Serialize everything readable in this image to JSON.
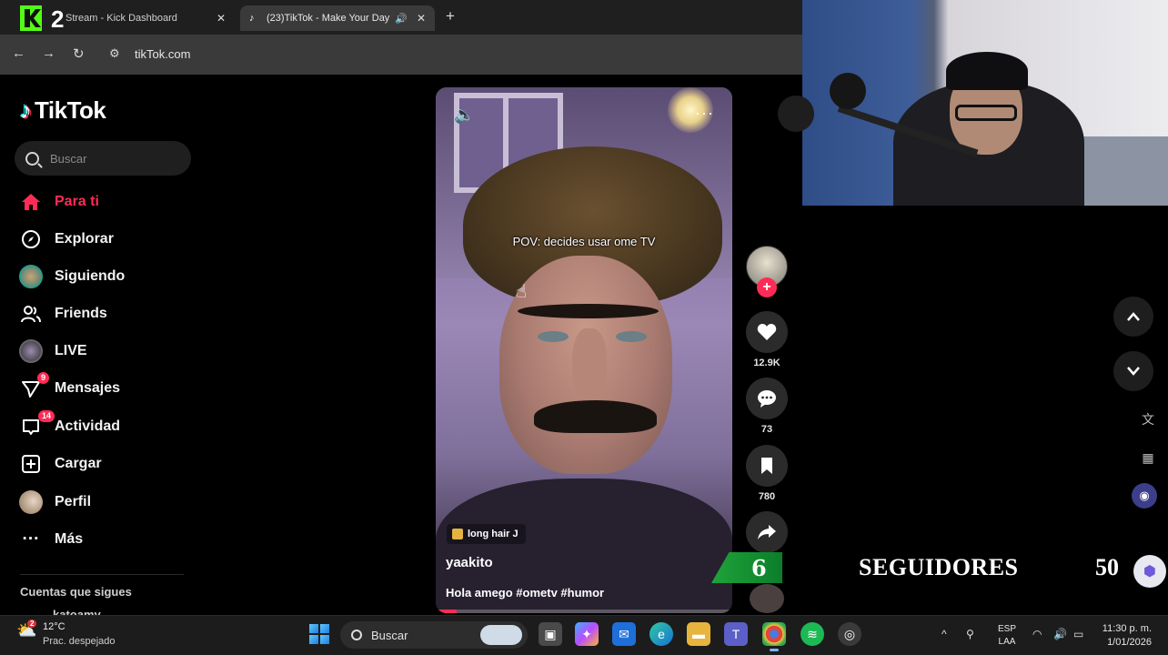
{
  "browser": {
    "tabs": [
      {
        "title": "Stream - Kick Dashboard",
        "active": false
      },
      {
        "title": "(23)TikTok - Make Your Day",
        "active": true
      }
    ],
    "url": "tikTok.com"
  },
  "stream_logo": "K2",
  "tiktok": {
    "brand": "TikTok",
    "search_placeholder": "Buscar",
    "nav": [
      {
        "label": "Para ti",
        "icon": "home-icon",
        "active": true
      },
      {
        "label": "Explorar",
        "icon": "compass-icon"
      },
      {
        "label": "Siguiendo",
        "icon": "avatar-icon"
      },
      {
        "label": "Friends",
        "icon": "friends-icon"
      },
      {
        "label": "LIVE",
        "icon": "live-icon"
      },
      {
        "label": "Mensajes",
        "icon": "send-icon",
        "badge": "9"
      },
      {
        "label": "Actividad",
        "icon": "inbox-icon",
        "badge": "14"
      },
      {
        "label": "Cargar",
        "icon": "upload-icon"
      },
      {
        "label": "Perfil",
        "icon": "profile-icon"
      },
      {
        "label": "Más",
        "icon": "more-icon"
      }
    ],
    "following_header": "Cuentas que sigues",
    "following_first": "katoamy",
    "accent": "#fe2c55"
  },
  "video": {
    "overlay_text": "POV: decides usar ome TV",
    "music": "long hair J",
    "author": "yaakito",
    "caption": "Hola amego #ometv #humor",
    "progress": 0.07,
    "likes": "12.9K",
    "comments": "73",
    "saves": "780"
  },
  "stream_overlay": {
    "followers_current": "6",
    "followers_label": "SEGUIDORES",
    "followers_goal": "50"
  },
  "taskbar": {
    "weather_temp": "12°C",
    "weather_desc": "Prac. despejado",
    "weather_badge": "2",
    "search_placeholder": "Buscar",
    "language_top": "ESP",
    "language_bottom": "LAA",
    "time": "11:30 p. m.",
    "date": "1/01/2026"
  }
}
